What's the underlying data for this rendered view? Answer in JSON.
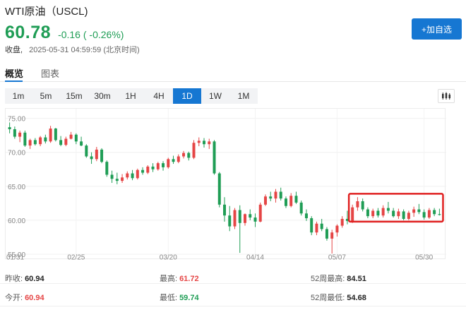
{
  "header": {
    "title": "WTI原油（USCL)",
    "price": "60.78",
    "change": "-0.16 ( -0.26%)",
    "status_label": "收盘,",
    "timestamp": "2025-05-31 04:59:59 (北京时间)",
    "add_watchlist_label": "+加自选"
  },
  "tabs": [
    {
      "label": "概览",
      "active": true
    },
    {
      "label": "图表",
      "active": false
    }
  ],
  "periods": [
    {
      "label": "1m",
      "active": false
    },
    {
      "label": "5m",
      "active": false
    },
    {
      "label": "15m",
      "active": false
    },
    {
      "label": "30m",
      "active": false
    },
    {
      "label": "1H",
      "active": false
    },
    {
      "label": "4H",
      "active": false
    },
    {
      "label": "1D",
      "active": true
    },
    {
      "label": "1W",
      "active": false
    },
    {
      "label": "1M",
      "active": false
    }
  ],
  "chart_type_icon": "candlestick-icon",
  "colors": {
    "up": "#e54545",
    "down": "#1f9d55",
    "accent": "#1677d2",
    "highlight": "#e02020"
  },
  "chart_data": {
    "type": "candlestick",
    "ylim": [
      55,
      76
    ],
    "y_ticks": [
      "75.00",
      "70.00",
      "65.00",
      "60.00",
      "55.00"
    ],
    "x_ticks": [
      {
        "label": "02/25",
        "index": 13
      },
      {
        "label": "03/20",
        "index": 31
      },
      {
        "label": "04/14",
        "index": 48
      },
      {
        "label": "05/07",
        "index": 64
      },
      {
        "label": "05/30",
        "index": 81
      }
    ],
    "x_left_label": "01/31",
    "candles": [
      [
        73.7,
        74.4,
        72.8,
        73.4
      ],
      [
        73.4,
        73.8,
        72.0,
        72.3
      ],
      [
        72.3,
        73.2,
        71.5,
        72.9
      ],
      [
        72.9,
        73.2,
        70.8,
        71.0
      ],
      [
        71.0,
        72.0,
        70.5,
        71.8
      ],
      [
        71.8,
        72.1,
        71.0,
        71.2
      ],
      [
        71.2,
        72.4,
        70.9,
        72.2
      ],
      [
        72.2,
        72.6,
        71.3,
        71.6
      ],
      [
        71.6,
        73.9,
        71.4,
        73.5
      ],
      [
        73.5,
        73.6,
        71.6,
        71.8
      ],
      [
        71.8,
        72.4,
        70.9,
        71.1
      ],
      [
        71.1,
        72.3,
        70.9,
        72.0
      ],
      [
        72.0,
        73.0,
        71.9,
        72.6
      ],
      [
        72.6,
        72.8,
        71.2,
        71.6
      ],
      [
        71.6,
        72.3,
        70.9,
        71.0
      ],
      [
        71.0,
        71.2,
        69.2,
        69.4
      ],
      [
        69.4,
        70.0,
        68.3,
        69.0
      ],
      [
        69.0,
        70.8,
        68.7,
        70.4
      ],
      [
        70.4,
        70.6,
        68.4,
        68.6
      ],
      [
        68.6,
        68.8,
        66.4,
        66.7
      ],
      [
        66.7,
        67.3,
        65.5,
        66.1
      ],
      [
        66.1,
        67.0,
        65.3,
        65.8
      ],
      [
        65.8,
        66.8,
        65.5,
        66.3
      ],
      [
        66.3,
        67.2,
        66.0,
        66.9
      ],
      [
        66.9,
        67.4,
        65.9,
        66.2
      ],
      [
        66.2,
        67.6,
        66.0,
        67.4
      ],
      [
        67.4,
        67.8,
        66.7,
        67.0
      ],
      [
        67.0,
        68.1,
        66.8,
        67.9
      ],
      [
        67.9,
        68.4,
        67.1,
        67.5
      ],
      [
        67.5,
        68.6,
        67.3,
        68.4
      ],
      [
        68.4,
        68.7,
        67.3,
        67.8
      ],
      [
        67.8,
        69.2,
        67.6,
        69.0
      ],
      [
        69.0,
        69.5,
        68.3,
        68.6
      ],
      [
        68.6,
        69.7,
        68.4,
        69.4
      ],
      [
        69.4,
        70.2,
        69.1,
        69.9
      ],
      [
        69.9,
        70.1,
        68.8,
        69.2
      ],
      [
        69.2,
        71.8,
        69.0,
        71.4
      ],
      [
        71.4,
        72.2,
        70.9,
        71.7
      ],
      [
        71.7,
        72.1,
        70.7,
        71.2
      ],
      [
        71.2,
        72.0,
        70.5,
        71.6
      ],
      [
        71.6,
        71.8,
        66.7,
        66.9
      ],
      [
        66.9,
        67.1,
        61.9,
        62.3
      ],
      [
        62.3,
        63.4,
        59.8,
        60.7
      ],
      [
        60.7,
        62.1,
        58.4,
        59.1
      ],
      [
        59.1,
        61.8,
        58.7,
        61.5
      ],
      [
        61.5,
        62.2,
        55.2,
        59.6
      ],
      [
        59.6,
        61.0,
        59.2,
        60.9
      ],
      [
        60.9,
        61.6,
        60.0,
        60.4
      ],
      [
        60.4,
        61.0,
        59.0,
        59.8
      ],
      [
        59.8,
        62.6,
        59.7,
        62.3
      ],
      [
        62.3,
        63.8,
        62.1,
        63.5
      ],
      [
        63.5,
        64.2,
        62.8,
        63.2
      ],
      [
        63.2,
        64.6,
        62.6,
        64.2
      ],
      [
        64.2,
        64.8,
        62.9,
        63.2
      ],
      [
        63.2,
        63.5,
        61.8,
        62.1
      ],
      [
        62.1,
        64.0,
        61.9,
        63.6
      ],
      [
        63.6,
        64.2,
        62.4,
        62.6
      ],
      [
        62.6,
        62.9,
        60.7,
        61.0
      ],
      [
        61.0,
        61.6,
        59.9,
        60.3
      ],
      [
        60.3,
        60.6,
        57.8,
        58.2
      ],
      [
        58.2,
        59.8,
        57.8,
        59.5
      ],
      [
        59.5,
        60.2,
        58.4,
        58.7
      ],
      [
        58.7,
        59.0,
        57.0,
        57.3
      ],
      [
        57.3,
        58.6,
        55.1,
        58.2
      ],
      [
        58.2,
        59.4,
        57.6,
        59.2
      ],
      [
        59.2,
        60.6,
        58.9,
        60.2
      ],
      [
        60.2,
        61.4,
        59.4,
        59.9
      ],
      [
        59.9,
        62.3,
        59.6,
        61.9
      ],
      [
        61.9,
        63.4,
        61.4,
        62.8
      ],
      [
        62.8,
        63.2,
        61.3,
        61.6
      ],
      [
        61.6,
        61.9,
        60.3,
        60.6
      ],
      [
        60.6,
        61.7,
        60.3,
        61.4
      ],
      [
        61.4,
        61.8,
        60.4,
        60.7
      ],
      [
        60.7,
        62.2,
        60.4,
        61.8
      ],
      [
        61.8,
        62.7,
        61.0,
        61.4
      ],
      [
        61.4,
        61.8,
        60.4,
        60.6
      ],
      [
        60.6,
        61.7,
        60.2,
        61.3
      ],
      [
        61.3,
        61.6,
        60.0,
        60.2
      ],
      [
        60.2,
        61.4,
        60.0,
        61.1
      ],
      [
        61.1,
        62.0,
        60.5,
        61.6
      ],
      [
        61.6,
        62.4,
        60.9,
        61.2
      ],
      [
        61.2,
        61.6,
        60.1,
        60.4
      ],
      [
        60.4,
        61.8,
        60.2,
        61.5
      ],
      [
        61.5,
        61.8,
        60.6,
        60.9
      ],
      [
        60.9,
        61.7,
        60.7,
        60.78
      ]
    ],
    "highlight_range": {
      "from_index": 67,
      "to_index": 84,
      "y_low": 59.8,
      "y_high": 63.9
    }
  },
  "stats": [
    {
      "label": "昨收:",
      "value": "60.94",
      "color": "default"
    },
    {
      "label": "最高:",
      "value": "61.72",
      "color": "red"
    },
    {
      "label": "52周最高:",
      "value": "84.51",
      "color": "default"
    },
    {
      "label": "今开:",
      "value": "60.94",
      "color": "red"
    },
    {
      "label": "最低:",
      "value": "59.74",
      "color": "green"
    },
    {
      "label": "52周最低:",
      "value": "54.68",
      "color": "default"
    }
  ]
}
